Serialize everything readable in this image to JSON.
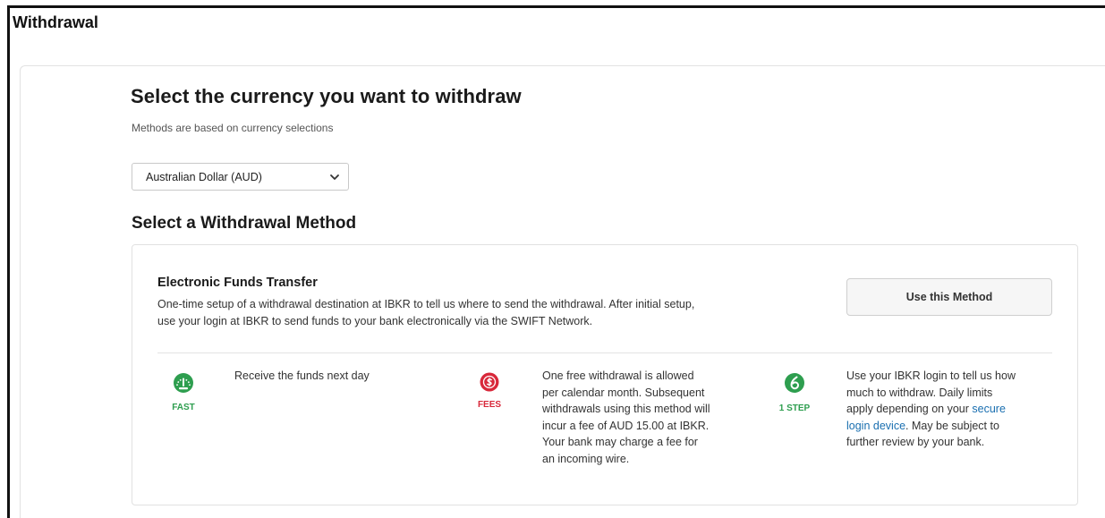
{
  "header": {
    "title": "Withdrawal"
  },
  "currency": {
    "heading": "Select the currency you want to withdraw",
    "subtext": "Methods are based on currency selections",
    "selected": "Australian Dollar (AUD)"
  },
  "method_section": {
    "heading": "Select a Withdrawal Method",
    "card": {
      "title": "Electronic Funds Transfer",
      "description_line1": "One-time setup of a withdrawal destination at IBKR to tell us where to send the withdrawal. After initial setup,",
      "description_line2": "use your login at IBKR to send funds to your bank electronically via the SWIFT Network.",
      "button_label": "Use this Method",
      "features": [
        {
          "icon": "speedometer-icon",
          "caption": "FAST",
          "color": "#2e9e4f",
          "lines": [
            "Receive the funds next day"
          ]
        },
        {
          "icon": "dollar-icon",
          "caption": "FEES",
          "color": "#d8283a",
          "lines": [
            "One free withdrawal is allowed",
            "per calendar month. Subsequent",
            "withdrawals using this method will",
            "incur a fee of AUD 15.00 at IBKR.",
            "Your bank may charge a fee for",
            "an incoming wire."
          ]
        },
        {
          "icon": "one-step-icon",
          "caption": "1 STEP",
          "color": "#2e9e4f",
          "line1": "Use your IBKR login to tell us how",
          "line2": "much to withdraw. Daily limits",
          "line3_prefix": "apply depending on your ",
          "line3_link": "secure",
          "line4_link": "login device",
          "line4_suffix": ". May be subject to",
          "line5": "further review by your bank."
        }
      ]
    }
  }
}
